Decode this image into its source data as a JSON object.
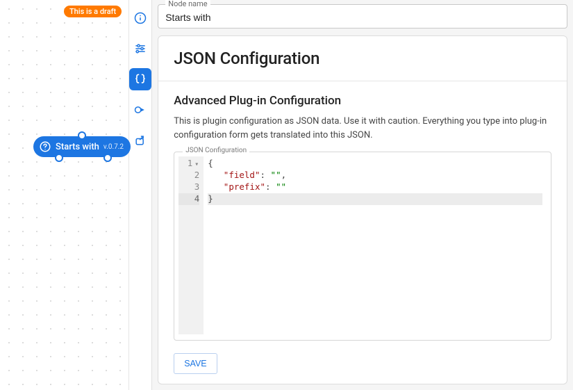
{
  "canvas": {
    "draft_badge": "This is a draft",
    "node": {
      "icon_name": "question-circle-icon",
      "label": "Starts with",
      "version": "v.0.7.2"
    }
  },
  "rail": {
    "items": [
      {
        "name": "info-icon",
        "active": false
      },
      {
        "name": "sliders-icon",
        "active": false
      },
      {
        "name": "json-braces-icon",
        "active": true
      },
      {
        "name": "run-icon",
        "active": false
      },
      {
        "name": "export-icon",
        "active": false
      }
    ]
  },
  "panel": {
    "node_name_label": "Node name",
    "node_name_value": "Starts with",
    "card_title": "JSON Configuration",
    "subheading": "Advanced Plug-in Configuration",
    "description": "This is plugin configuration as JSON data. Use it with caution. Everything you type into plug-in configuration form gets translated into this JSON.",
    "editor_label": "JSON Configuration",
    "code": {
      "lines": [
        "1",
        "2",
        "3",
        "4"
      ],
      "l1_brace": "{",
      "l2_key": "\"field\"",
      "l2_colon": ": ",
      "l2_val": "\"\"",
      "l2_comma": ",",
      "l3_key": "\"prefix\"",
      "l3_colon": ": ",
      "l3_val": "\"\"",
      "l4_brace": "}"
    },
    "save_label": "SAVE"
  }
}
